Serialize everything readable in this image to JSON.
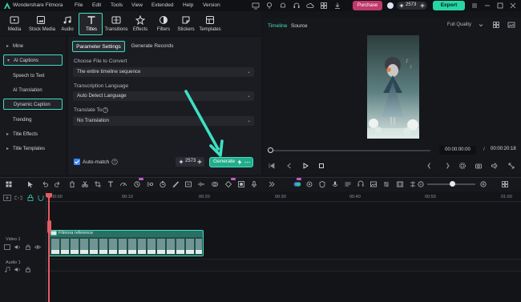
{
  "titlebar": {
    "app_title": "Wondershare Filmora",
    "menus": [
      "File",
      "Edit",
      "Tools",
      "View",
      "Extended",
      "Help",
      "Version"
    ],
    "purchase_label": "Purchase",
    "credits": "2573",
    "export_label": "Export"
  },
  "toolbar": {
    "tools": [
      {
        "label": "Media",
        "icon": "media-icon"
      },
      {
        "label": "Stock Media",
        "icon": "stock-media-icon"
      },
      {
        "label": "Audio",
        "icon": "audio-icon"
      },
      {
        "label": "Titles",
        "icon": "titles-icon"
      },
      {
        "label": "Transitions",
        "icon": "transitions-icon"
      },
      {
        "label": "Effects",
        "icon": "effects-icon"
      },
      {
        "label": "Filters",
        "icon": "filters-icon"
      },
      {
        "label": "Stickers",
        "icon": "stickers-icon"
      },
      {
        "label": "Templates",
        "icon": "templates-icon"
      }
    ]
  },
  "left_panel": {
    "items": [
      {
        "label": "Mine",
        "caret": "▸"
      },
      {
        "label": "AI Captions",
        "caret": "▾"
      },
      {
        "label": "Speech to Text",
        "caret": ""
      },
      {
        "label": "AI Translation",
        "caret": ""
      },
      {
        "label": "Dynamic Caption",
        "caret": ""
      },
      {
        "label": "Trending",
        "caret": ""
      },
      {
        "label": "Title Effects",
        "caret": "▸"
      },
      {
        "label": "Title Templates",
        "caret": "▸"
      }
    ]
  },
  "options": {
    "tab_params": "Parameter Settings",
    "tab_records": "Generate Records",
    "file_label": "Choose File to Convert",
    "file_value": "The entire timeline sequence",
    "lang_label": "Transcription Language",
    "lang_value": "Auto Detect Language",
    "translate_label": "Translate To",
    "translate_value": "No Translation",
    "auto_match": "Auto-match",
    "cost": "2573",
    "generate": "Generate"
  },
  "preview": {
    "tab_timeline": "Timeline",
    "tab_source": "Source",
    "quality": "Full Quality",
    "time_current": "00:00:00:00",
    "time_sep": "/",
    "time_total": "00:00:20:18"
  },
  "timeline": {
    "ruler": [
      "00:00",
      "00:10",
      "00:20",
      "00:30",
      "00:40",
      "00:50",
      "01:00"
    ],
    "video_track": "Video 1",
    "audio_track": "Audio 1",
    "clip_name": "Filmora reference"
  },
  "colors": {
    "accent": "#3de0c3",
    "export": "#26d6a4",
    "purchase": "#c0396b",
    "playhead": "#e65b63"
  }
}
